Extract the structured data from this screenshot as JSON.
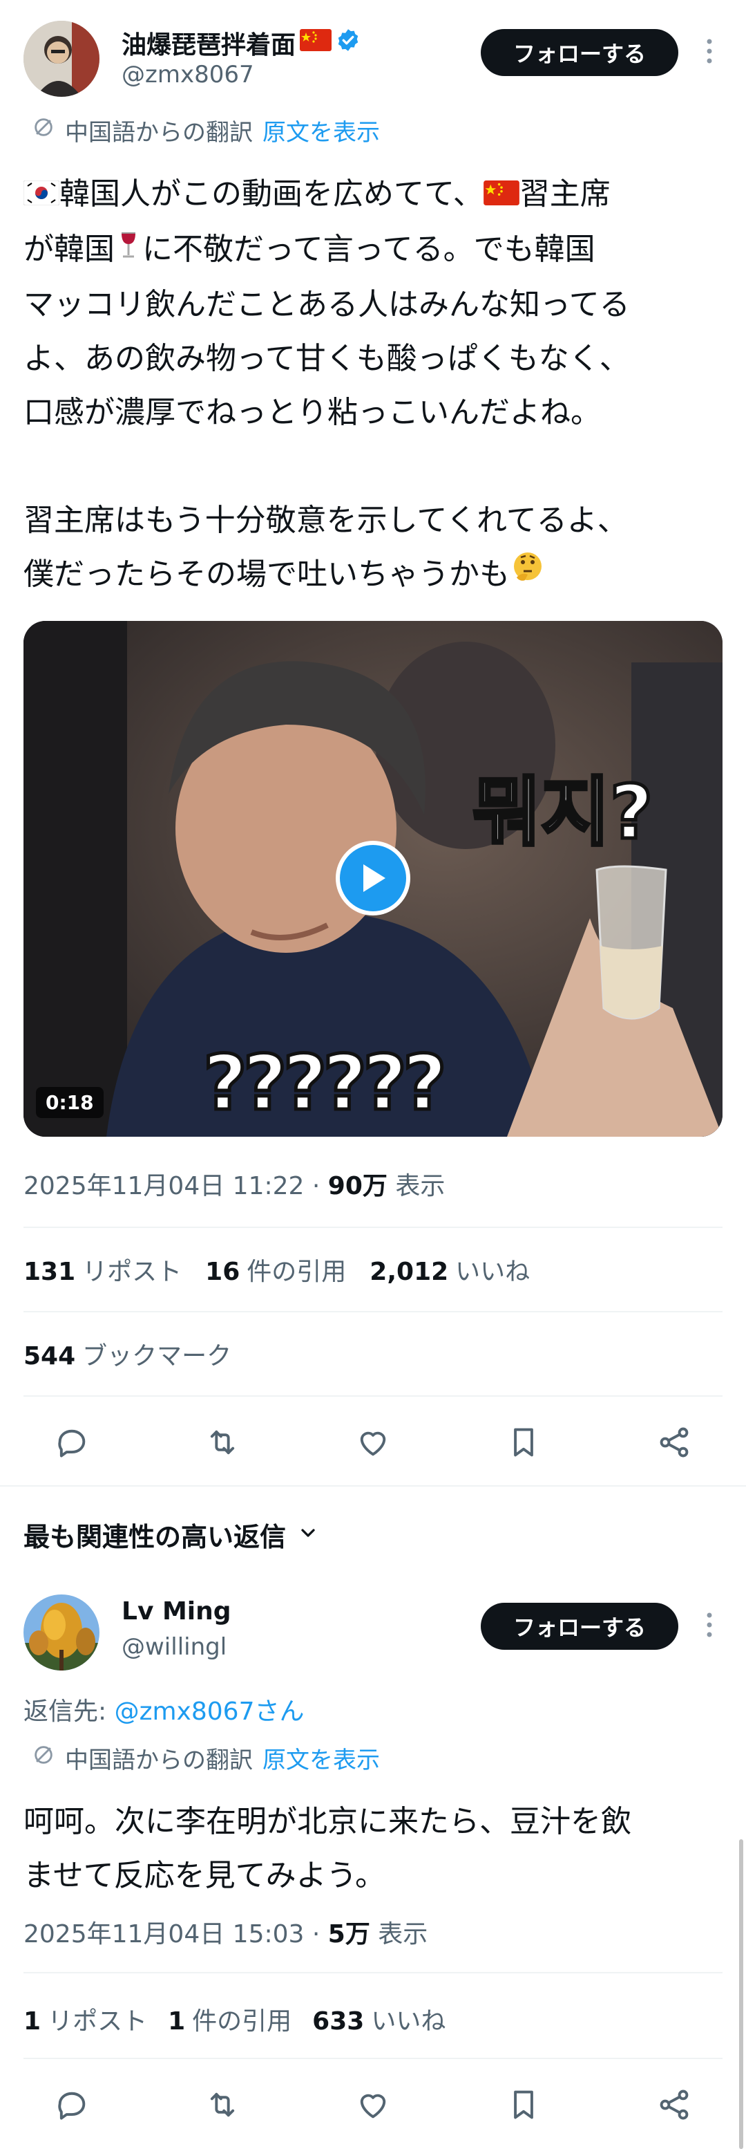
{
  "tweet": {
    "author_name": "油爆琵琶拌着面",
    "author_handle": "@zmx8067",
    "follow_label": "フォローする",
    "translation_note": "中国語からの翻訳",
    "show_original": "原文を表示",
    "text_lines": [
      "韓国人がこの動画を広めてて、",
      "習主席",
      "が韓国",
      "に不敬だって言ってる。でも韓国",
      "マッコリ飲んだことある人はみんな知ってる",
      "よ、あの飲み物って甘くも酸っぱくもなく、",
      "口感が濃厚でねっとり粘っこいんだよね。",
      "習主席はもう十分敬意を示してくれてるよ、",
      "僕だったらその場で吐いちゃうかも"
    ],
    "video": {
      "duration": "0:18",
      "caption_korean": "뭐지?",
      "caption_questions": "??????"
    },
    "timestamp": "2025年11月04日 11:22",
    "views_count": "90万",
    "views_label": "表示",
    "reposts_count": "131",
    "reposts_label": "リポスト",
    "quotes_count": "16",
    "quotes_label": "件の引用",
    "likes_count": "2,012",
    "likes_label": "いいね",
    "bookmarks_count": "544",
    "bookmarks_label": "ブックマーク"
  },
  "replies_header": "最も関連性の高い返信",
  "reply": {
    "author_name": "Lv Ming",
    "author_handle": "@willingl",
    "follow_label": "フォローする",
    "reply_to_label": "返信先:",
    "reply_to_handle": "@zmx8067さん",
    "translation_note": "中国語からの翻訳",
    "show_original": "原文を表示",
    "text_lines": [
      "呵呵。次に李在明が北京に来たら、豆汁を飲",
      "ませて反応を見てみよう。"
    ],
    "timestamp": "2025年11月04日 15:03",
    "views_count": "5万",
    "views_label": "表示",
    "reposts_count": "1",
    "reposts_label": "リポスト",
    "quotes_count": "1",
    "quotes_label": "件の引用",
    "likes_count": "633",
    "likes_label": "いいね"
  },
  "colors": {
    "accent": "#1d9bf0",
    "text_primary": "#0f1419",
    "text_secondary": "#536471",
    "divider": "#eff3f4",
    "follow_bg": "#0f1419"
  },
  "icons": [
    "verified-badge-icon",
    "china-flag-icon",
    "korea-flag-icon",
    "wine-glass-icon",
    "thinking-face-icon",
    "translate-icon",
    "play-icon",
    "reply-icon",
    "repost-icon",
    "like-icon",
    "bookmark-icon",
    "share-icon",
    "chevron-down-icon",
    "more-icon"
  ]
}
